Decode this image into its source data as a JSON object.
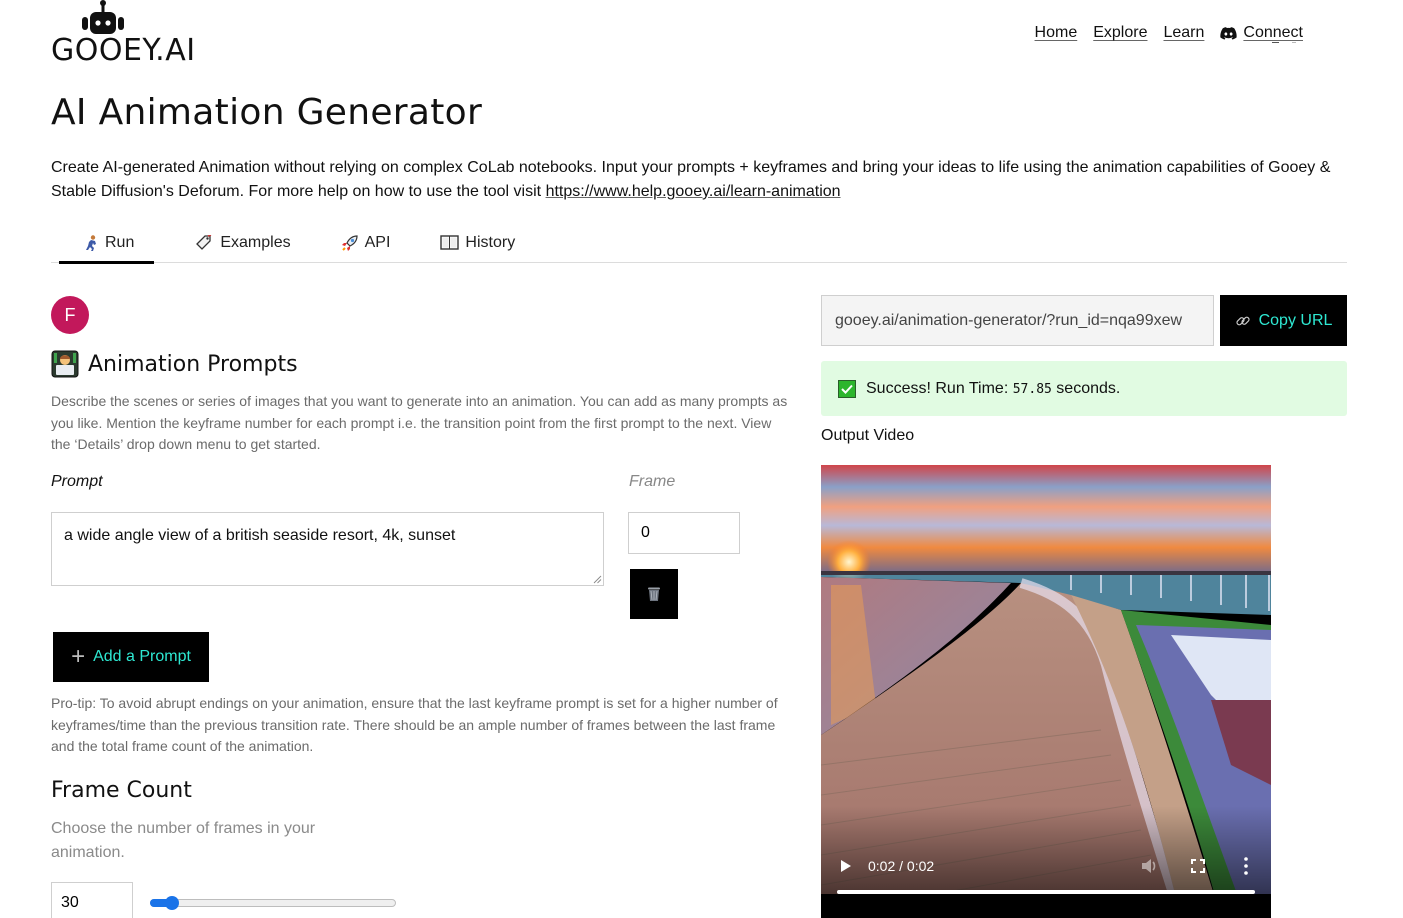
{
  "brand": {
    "name": "GOOEY.AI",
    "logo_icon": "robot-icon"
  },
  "nav": {
    "items": [
      {
        "label": "Home"
      },
      {
        "label": "Explore"
      },
      {
        "label": "Learn"
      },
      {
        "label": "Connect",
        "icon": "discord-icon"
      }
    ]
  },
  "page": {
    "title": "AI Animation Generator",
    "intro_text": "Create AI-generated Animation without relying on complex CoLab notebooks. Input your prompts + keyframes and bring your ideas to life using the animation capabilities of Gooey & Stable Diffusion's Deforum. For more help on how to use the tool visit ",
    "intro_link": "https://www.help.gooey.ai/learn-animation"
  },
  "tabs": [
    {
      "label": "Run",
      "icon": "running-person-icon",
      "active": true
    },
    {
      "label": "Examples",
      "icon": "tag-icon",
      "active": false
    },
    {
      "label": "API",
      "icon": "rocket-icon",
      "active": false
    },
    {
      "label": "History",
      "icon": "book-icon",
      "active": false
    }
  ],
  "user": {
    "avatar_initial": "F",
    "avatar_color": "#c2185b"
  },
  "prompts_section": {
    "title": "Animation Prompts",
    "icon": "technologist-icon",
    "description": "Describe the scenes or series of images that you want to generate into an animation. You can add as many prompts as you like. Mention the keyframe number for each prompt i.e. the transition point from the first prompt to the next. View the ‘Details’ drop down menu to get started.",
    "prompt_label": "Prompt",
    "frame_label": "Frame",
    "rows": [
      {
        "prompt": "a wide angle view of a british seaside resort, 4k, sunset",
        "frame": "0"
      }
    ],
    "add_button_label": "Add a Prompt",
    "pro_tip": "Pro-tip: To avoid abrupt endings on your animation, ensure that the last keyframe prompt is set for a higher number of keyframes/time than the previous transition rate. There should be an ample number of frames between the last frame and the total frame count of the animation."
  },
  "frame_count": {
    "title": "Frame Count",
    "description": "Choose the number of frames in your animation.",
    "value": "30",
    "slider_fraction": 0.05
  },
  "output": {
    "share_url": "gooey.ai/animation-generator/?run_id=nqa99xew",
    "copy_button_label": "Copy URL",
    "status_prefix": "Success! Run Time: ",
    "run_time": "57.85",
    "status_suffix": " seconds.",
    "output_label": "Output Video",
    "video_time": "0:02 / 0:02",
    "video_progress": 1.0
  },
  "colors": {
    "accent": "#2ee8d2",
    "success_bg": "#e1fbe2",
    "slider": "#1a73e8"
  }
}
